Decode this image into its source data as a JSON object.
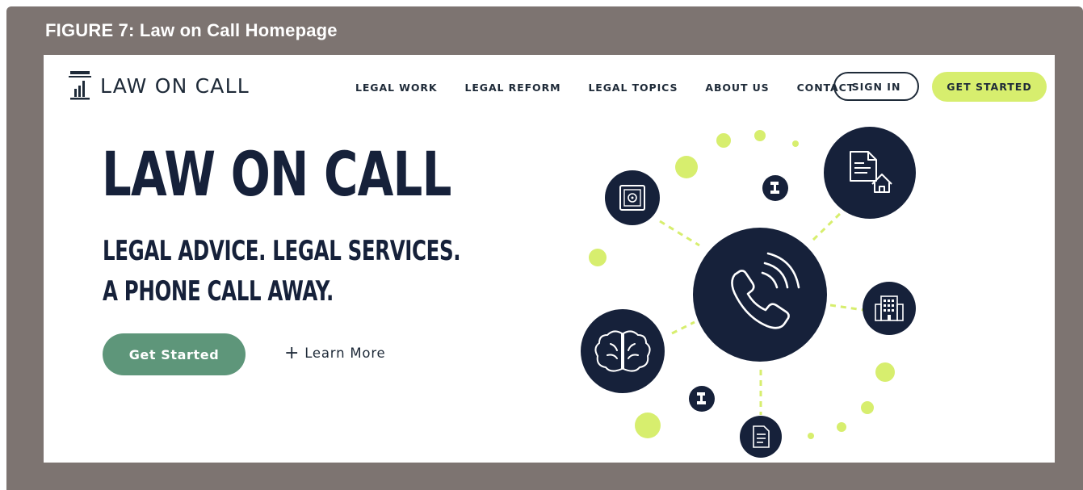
{
  "caption": "FIGURE 7: Law on Call Homepage",
  "brand": {
    "name": "LAW ON CALL",
    "logo_icon": "courthouse-column-icon"
  },
  "nav": {
    "items": [
      {
        "label": "LEGAL WORK"
      },
      {
        "label": "LEGAL REFORM"
      },
      {
        "label": "LEGAL TOPICS"
      },
      {
        "label": "ABOUT US"
      },
      {
        "label": "CONTACT"
      }
    ],
    "sign_in": "SIGN IN",
    "get_started": "GET STARTED"
  },
  "hero": {
    "title": "LAW ON CALL",
    "subtitle_line1": "LEGAL ADVICE. LEGAL SERVICES.",
    "subtitle_line2": "A PHONE CALL AWAY.",
    "cta_primary": "Get Started",
    "cta_secondary": "Learn More",
    "cta_secondary_icon": "plus-icon"
  },
  "illustration": {
    "center_icon": "phone-call-icon",
    "satellite_icons": [
      "safe-icon",
      "document-house-icon",
      "office-building-icon",
      "brain-icon",
      "document-icon",
      "gavel-icon",
      "gavel-icon"
    ]
  },
  "colors": {
    "frame": "#7d7471",
    "navy": "#16213a",
    "lime": "#d7ee6e",
    "green": "#5e967a"
  }
}
